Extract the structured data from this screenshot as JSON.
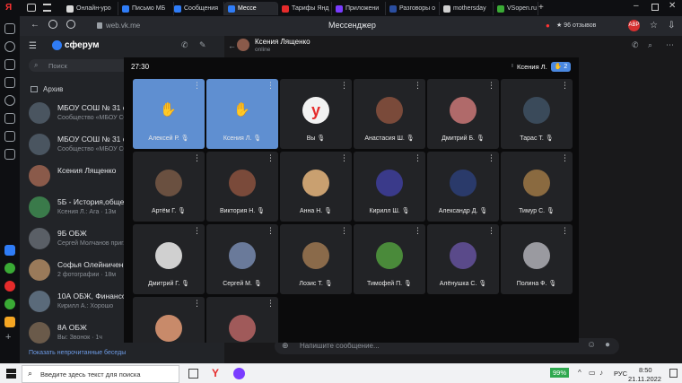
{
  "browser": {
    "tabs": [
      {
        "label": "Онлайн-уро",
        "color": "#d9d9d9"
      },
      {
        "label": "Письмо МБ",
        "color": "#2f7cf6"
      },
      {
        "label": "Сообщения",
        "color": "#2f7cf6"
      },
      {
        "label": "Мессе",
        "color": "#2f7cf6",
        "active": true
      },
      {
        "label": "Тарифы Янд",
        "color": "#e52b2b"
      },
      {
        "label": "Приложени",
        "color": "#7a3cff"
      },
      {
        "label": "Разговоры о",
        "color": "#2a4ea0"
      },
      {
        "label": "mothersday",
        "color": "#d0d0d0"
      },
      {
        "label": "VSopen.ru :",
        "color": "#3aaa35"
      }
    ],
    "url": "web.vk.me",
    "page_title": "Мессенджер",
    "reviews": "★ 96 отзывов"
  },
  "sidebar": {
    "app_name": "сферум",
    "search_placeholder": "Поиск",
    "archive_label": "Архив",
    "chats": [
      {
        "title": "МБОУ СОШ № 31 с",
        "sub": "Сообщество «МБОУ СОШ"
      },
      {
        "title": "МБОУ СОШ № 31 с",
        "sub": "Сообщество «МБОУ СОШ"
      },
      {
        "title": "Ксения Лященко",
        "sub": ""
      },
      {
        "title": "5Б - История,общес",
        "sub": "Ксения Л.: Ага · 13м"
      },
      {
        "title": "9Б ОБЖ",
        "sub": "Сергей Молчанов приглаш"
      },
      {
        "title": "Софья Олейничен",
        "sub": "2 фотографии · 18м"
      },
      {
        "title": "10А ОБЖ, Финансо",
        "sub": "Кирилл А.: Хорошо"
      },
      {
        "title": "8А ОБЖ",
        "sub": "Вы: Звонок · 1ч"
      }
    ],
    "show_unread": "Показать непрочитанные беседы"
  },
  "main": {
    "contact_name": "Ксения Лященко",
    "contact_status": "online",
    "message_placeholder": "Напишите сообщение..."
  },
  "call": {
    "timer": "27:30",
    "speaker": "Ксения Л.",
    "hands_count": "2",
    "participants": [
      {
        "name": "Алексей Р.",
        "raised": true
      },
      {
        "name": "Ксения Л.",
        "raised": true
      },
      {
        "name": "Вы",
        "raised": false
      },
      {
        "name": "Анастасия Ш.",
        "raised": false
      },
      {
        "name": "Дмитрий Б.",
        "raised": false
      },
      {
        "name": "Тарас Т.",
        "raised": false
      },
      {
        "name": "Артём Г.",
        "raised": false
      },
      {
        "name": "Виктория Н.",
        "raised": false
      },
      {
        "name": "Анна Н.",
        "raised": false
      },
      {
        "name": "Кирилл Ш.",
        "raised": false
      },
      {
        "name": "Александр Д.",
        "raised": false
      },
      {
        "name": "Тимур С.",
        "raised": false
      },
      {
        "name": "Дмитрий Г.",
        "raised": false
      },
      {
        "name": "Сергей М.",
        "raised": false
      },
      {
        "name": "Лозис Т.",
        "raised": false
      },
      {
        "name": "Тимофей П.",
        "raised": false
      },
      {
        "name": "Алёнушка С.",
        "raised": false
      },
      {
        "name": "Полина Ф.",
        "raised": false
      },
      {
        "name": "",
        "raised": false
      },
      {
        "name": "",
        "raised": false
      }
    ]
  },
  "taskbar": {
    "search_placeholder": "Введите здесь текст для поиска",
    "battery": "99%",
    "lang": "РУС",
    "time": "8:50",
    "date": "21.11.2022"
  }
}
